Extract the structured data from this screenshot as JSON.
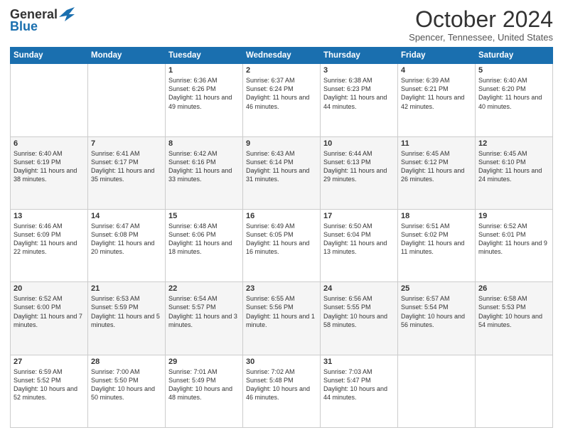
{
  "header": {
    "logo_general": "General",
    "logo_blue": "Blue",
    "month_title": "October 2024",
    "location": "Spencer, Tennessee, United States"
  },
  "days_of_week": [
    "Sunday",
    "Monday",
    "Tuesday",
    "Wednesday",
    "Thursday",
    "Friday",
    "Saturday"
  ],
  "weeks": [
    [
      {
        "day": "",
        "info": ""
      },
      {
        "day": "",
        "info": ""
      },
      {
        "day": "1",
        "info": "Sunrise: 6:36 AM\nSunset: 6:26 PM\nDaylight: 11 hours and 49 minutes."
      },
      {
        "day": "2",
        "info": "Sunrise: 6:37 AM\nSunset: 6:24 PM\nDaylight: 11 hours and 46 minutes."
      },
      {
        "day": "3",
        "info": "Sunrise: 6:38 AM\nSunset: 6:23 PM\nDaylight: 11 hours and 44 minutes."
      },
      {
        "day": "4",
        "info": "Sunrise: 6:39 AM\nSunset: 6:21 PM\nDaylight: 11 hours and 42 minutes."
      },
      {
        "day": "5",
        "info": "Sunrise: 6:40 AM\nSunset: 6:20 PM\nDaylight: 11 hours and 40 minutes."
      }
    ],
    [
      {
        "day": "6",
        "info": "Sunrise: 6:40 AM\nSunset: 6:19 PM\nDaylight: 11 hours and 38 minutes."
      },
      {
        "day": "7",
        "info": "Sunrise: 6:41 AM\nSunset: 6:17 PM\nDaylight: 11 hours and 35 minutes."
      },
      {
        "day": "8",
        "info": "Sunrise: 6:42 AM\nSunset: 6:16 PM\nDaylight: 11 hours and 33 minutes."
      },
      {
        "day": "9",
        "info": "Sunrise: 6:43 AM\nSunset: 6:14 PM\nDaylight: 11 hours and 31 minutes."
      },
      {
        "day": "10",
        "info": "Sunrise: 6:44 AM\nSunset: 6:13 PM\nDaylight: 11 hours and 29 minutes."
      },
      {
        "day": "11",
        "info": "Sunrise: 6:45 AM\nSunset: 6:12 PM\nDaylight: 11 hours and 26 minutes."
      },
      {
        "day": "12",
        "info": "Sunrise: 6:45 AM\nSunset: 6:10 PM\nDaylight: 11 hours and 24 minutes."
      }
    ],
    [
      {
        "day": "13",
        "info": "Sunrise: 6:46 AM\nSunset: 6:09 PM\nDaylight: 11 hours and 22 minutes."
      },
      {
        "day": "14",
        "info": "Sunrise: 6:47 AM\nSunset: 6:08 PM\nDaylight: 11 hours and 20 minutes."
      },
      {
        "day": "15",
        "info": "Sunrise: 6:48 AM\nSunset: 6:06 PM\nDaylight: 11 hours and 18 minutes."
      },
      {
        "day": "16",
        "info": "Sunrise: 6:49 AM\nSunset: 6:05 PM\nDaylight: 11 hours and 16 minutes."
      },
      {
        "day": "17",
        "info": "Sunrise: 6:50 AM\nSunset: 6:04 PM\nDaylight: 11 hours and 13 minutes."
      },
      {
        "day": "18",
        "info": "Sunrise: 6:51 AM\nSunset: 6:02 PM\nDaylight: 11 hours and 11 minutes."
      },
      {
        "day": "19",
        "info": "Sunrise: 6:52 AM\nSunset: 6:01 PM\nDaylight: 11 hours and 9 minutes."
      }
    ],
    [
      {
        "day": "20",
        "info": "Sunrise: 6:52 AM\nSunset: 6:00 PM\nDaylight: 11 hours and 7 minutes."
      },
      {
        "day": "21",
        "info": "Sunrise: 6:53 AM\nSunset: 5:59 PM\nDaylight: 11 hours and 5 minutes."
      },
      {
        "day": "22",
        "info": "Sunrise: 6:54 AM\nSunset: 5:57 PM\nDaylight: 11 hours and 3 minutes."
      },
      {
        "day": "23",
        "info": "Sunrise: 6:55 AM\nSunset: 5:56 PM\nDaylight: 11 hours and 1 minute."
      },
      {
        "day": "24",
        "info": "Sunrise: 6:56 AM\nSunset: 5:55 PM\nDaylight: 10 hours and 58 minutes."
      },
      {
        "day": "25",
        "info": "Sunrise: 6:57 AM\nSunset: 5:54 PM\nDaylight: 10 hours and 56 minutes."
      },
      {
        "day": "26",
        "info": "Sunrise: 6:58 AM\nSunset: 5:53 PM\nDaylight: 10 hours and 54 minutes."
      }
    ],
    [
      {
        "day": "27",
        "info": "Sunrise: 6:59 AM\nSunset: 5:52 PM\nDaylight: 10 hours and 52 minutes."
      },
      {
        "day": "28",
        "info": "Sunrise: 7:00 AM\nSunset: 5:50 PM\nDaylight: 10 hours and 50 minutes."
      },
      {
        "day": "29",
        "info": "Sunrise: 7:01 AM\nSunset: 5:49 PM\nDaylight: 10 hours and 48 minutes."
      },
      {
        "day": "30",
        "info": "Sunrise: 7:02 AM\nSunset: 5:48 PM\nDaylight: 10 hours and 46 minutes."
      },
      {
        "day": "31",
        "info": "Sunrise: 7:03 AM\nSunset: 5:47 PM\nDaylight: 10 hours and 44 minutes."
      },
      {
        "day": "",
        "info": ""
      },
      {
        "day": "",
        "info": ""
      }
    ]
  ]
}
